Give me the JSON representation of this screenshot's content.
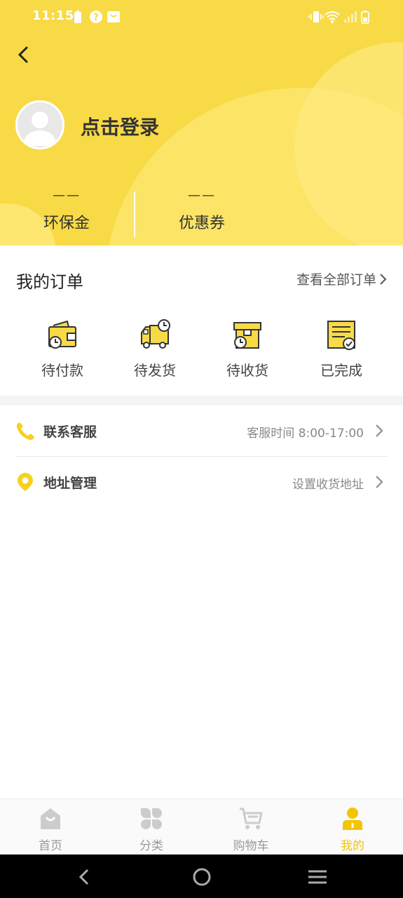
{
  "status_bar": {
    "time": "11:15"
  },
  "header": {
    "login_text": "点击登录",
    "stats": [
      {
        "value": "——",
        "label": "环保金"
      },
      {
        "value": "——",
        "label": "优惠券"
      }
    ]
  },
  "orders": {
    "title": "我的订单",
    "view_all": "查看全部订单",
    "items": [
      {
        "label": "待付款",
        "icon": "wallet-clock-icon"
      },
      {
        "label": "待发货",
        "icon": "truck-clock-icon"
      },
      {
        "label": "待收货",
        "icon": "box-clock-icon"
      },
      {
        "label": "已完成",
        "icon": "document-check-icon"
      }
    ]
  },
  "list": [
    {
      "title": "联系客服",
      "subtitle": "客服时间 8:00-17:00",
      "icon": "phone-icon"
    },
    {
      "title": "地址管理",
      "subtitle": "设置收货地址",
      "icon": "location-pin-icon"
    }
  ],
  "tabbar": {
    "tabs": [
      {
        "label": "首页",
        "icon": "home-bag-icon",
        "active": false
      },
      {
        "label": "分类",
        "icon": "category-icon",
        "active": false
      },
      {
        "label": "购物车",
        "icon": "cart-icon",
        "active": false
      },
      {
        "label": "我的",
        "icon": "profile-icon",
        "active": true
      }
    ]
  },
  "colors": {
    "accent": "#F8DA46",
    "active_tab": "#F5C400",
    "icon_dark": "#333333"
  }
}
